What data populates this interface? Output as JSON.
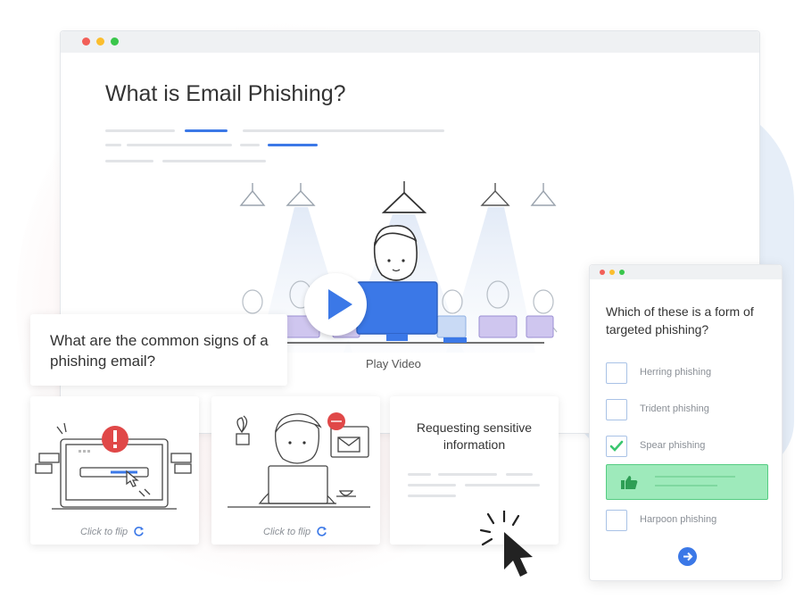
{
  "main_window": {
    "title": "What is Email Phishing?",
    "play_label": "Play Video"
  },
  "question_card": {
    "text": "What are the common signs of a phishing email?"
  },
  "flip_cards": [
    {
      "label": "Click to flip",
      "icon": "alert-laptop-illustration"
    },
    {
      "label": "Click to flip",
      "icon": "person-email-illustration"
    },
    {
      "text": "Requesting sensitive information"
    }
  ],
  "quiz": {
    "question": "Which of these is a form of targeted phishing?",
    "options": [
      {
        "label": "Herring phishing",
        "checked": false
      },
      {
        "label": "Trident phishing",
        "checked": false
      },
      {
        "label": "Spear phishing",
        "checked": true
      },
      {
        "label": "Harpoon phishing",
        "checked": false
      }
    ]
  },
  "colors": {
    "accent_blue": "#3b78e7",
    "success_green": "#55cc82",
    "alert_red": "#e04848",
    "dot_red": "#f25f58",
    "dot_yellow": "#fbbe2e",
    "dot_green": "#3ac64b"
  }
}
